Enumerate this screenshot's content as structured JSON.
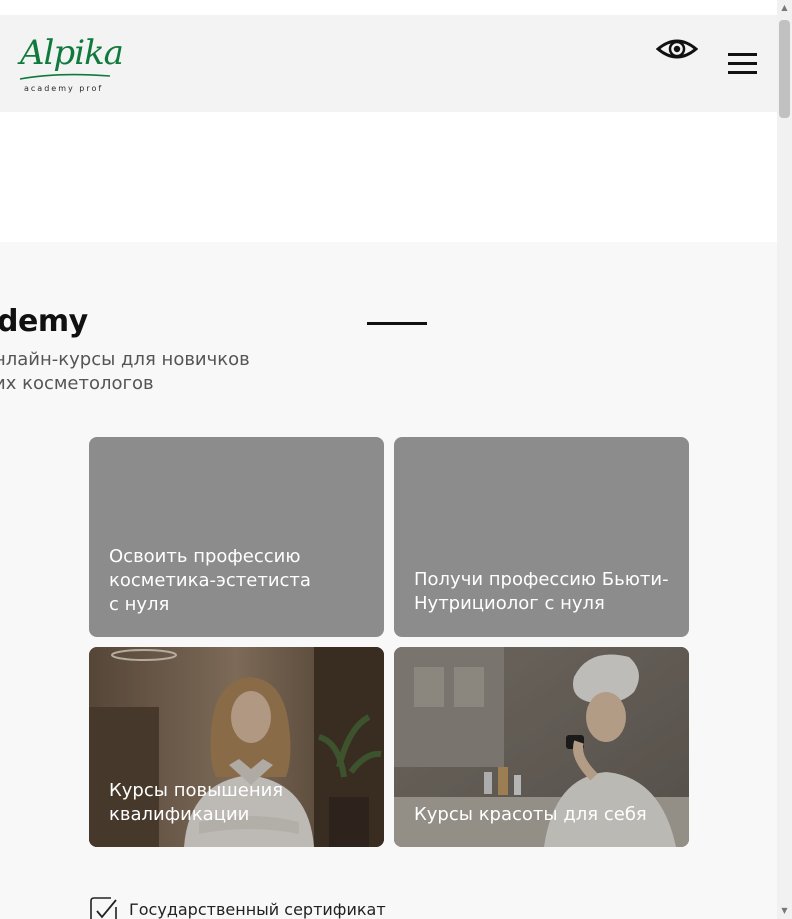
{
  "header": {
    "logo_script": "Alpika",
    "logo_tagline": "academy prof",
    "icons": {
      "accessibility": "eye-icon",
      "menu": "hamburger-menu-icon"
    }
  },
  "hero": {
    "title": "demy",
    "subtitle_line1": "нлайн-курсы для новичков",
    "subtitle_line2": "их косметологов"
  },
  "cards": [
    {
      "title": "Освоить профессию косметика-эстетиста с нуля"
    },
    {
      "title": "Получи профессию Бьюти-Нутрициолог с нуля"
    },
    {
      "title": "Курсы повышения квалификации"
    },
    {
      "title": "Курсы красоты для себя"
    }
  ],
  "features": [
    {
      "label": "Государственный сертификат",
      "icon": "checkbox-check-icon"
    }
  ],
  "colors": {
    "brand_green": "#0f7a3c",
    "header_bg": "#f3f3f3",
    "section_bg": "#f8f8f8",
    "card_overlay": "#8c8c8c"
  }
}
